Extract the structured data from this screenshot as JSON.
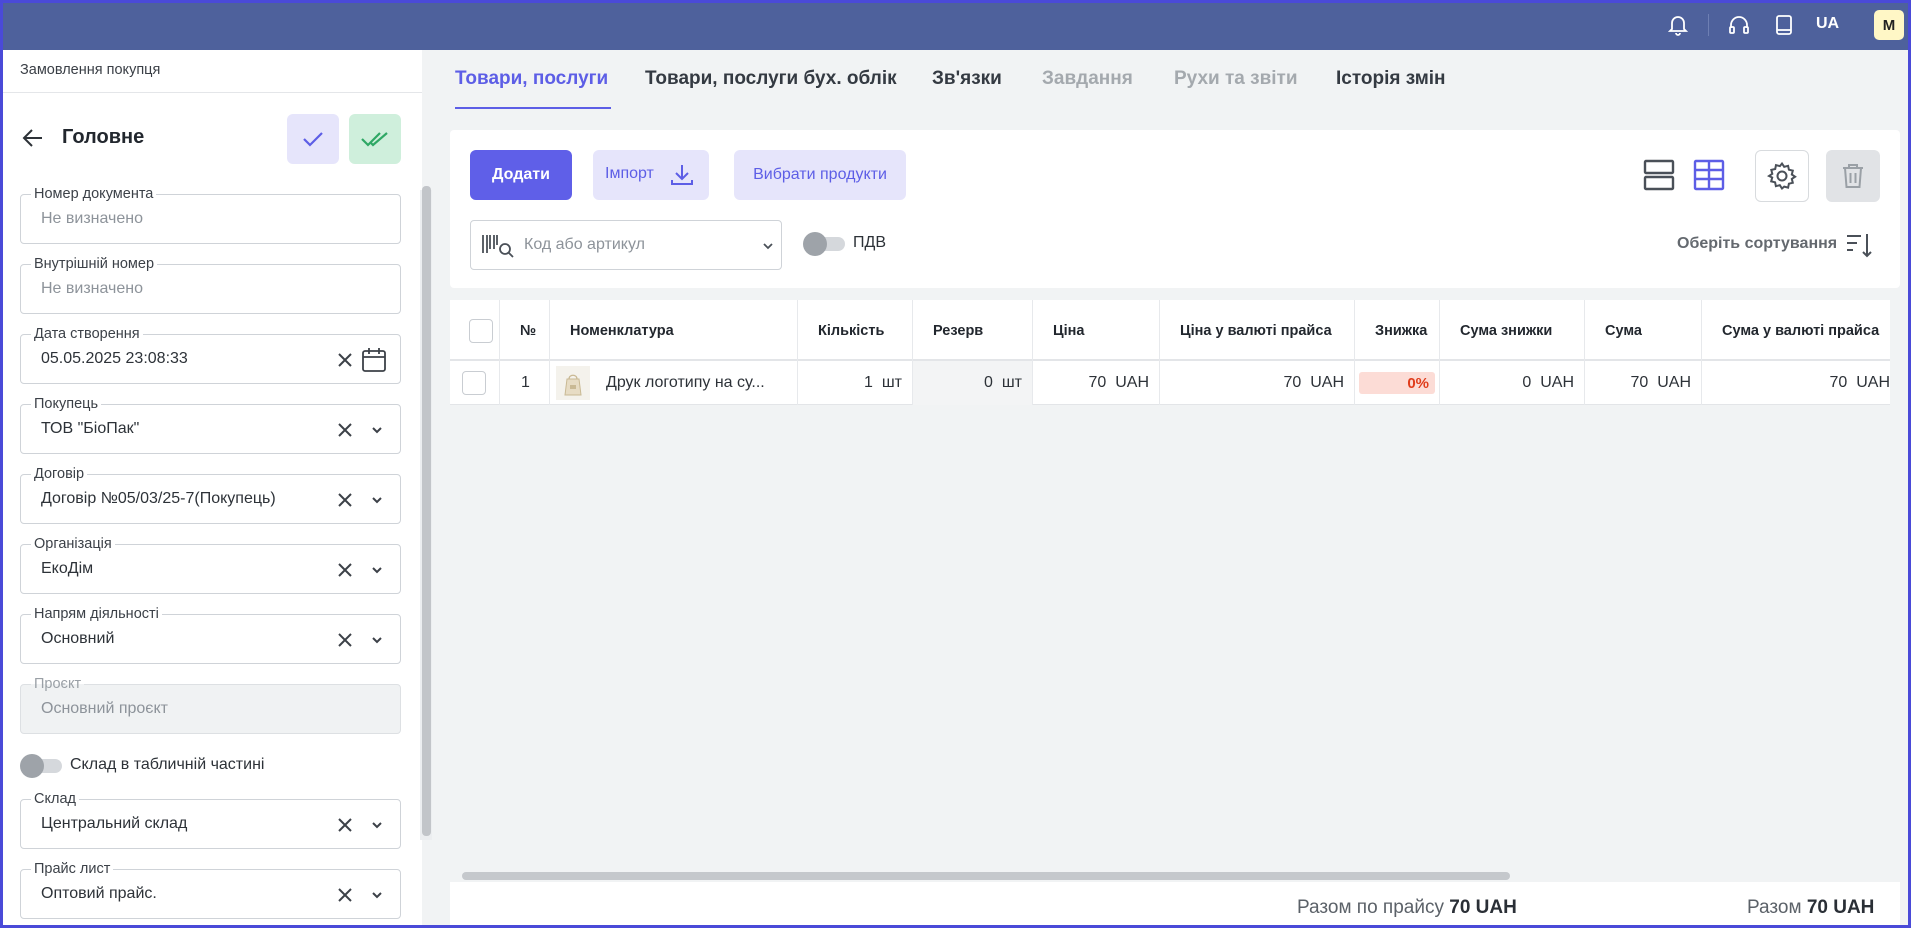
{
  "topbar": {
    "icons": [
      "bell-icon",
      "headset-icon",
      "book-icon"
    ],
    "language": "UA",
    "avatar_initial": "M"
  },
  "sidebar": {
    "breadcrumb": "Замовлення покупця",
    "title": "Головне",
    "fields": {
      "doc_number": {
        "label": "Номер документа",
        "placeholder": "Не визначено"
      },
      "internal_number": {
        "label": "Внутрішній номер",
        "placeholder": "Не визначено"
      },
      "created_date": {
        "label": "Дата створення",
        "value": "05.05.2025 23:08:33"
      },
      "buyer": {
        "label": "Покупець",
        "value": "ТОВ \"БіоПак\""
      },
      "contract": {
        "label": "Договір",
        "value": "Договір №05/03/25-7(Покупець)"
      },
      "organization": {
        "label": "Організація",
        "value": "ЕкоДім"
      },
      "activity": {
        "label": "Напрям діяльності",
        "value": "Основний"
      },
      "project": {
        "label": "Проєкт",
        "value": "Основний проєкт"
      },
      "warehouse_toggle": {
        "label": "Склад в табличній частині",
        "on": false
      },
      "warehouse": {
        "label": "Склад",
        "value": "Центральний склад"
      },
      "price_list": {
        "label": "Прайс лист",
        "value": "Оптовий прайс."
      }
    }
  },
  "tabs": [
    {
      "label": "Товари, послуги",
      "state": "active"
    },
    {
      "label": "Товари, послуги бух. облік",
      "state": "normal"
    },
    {
      "label": "Зв'язки",
      "state": "normal"
    },
    {
      "label": "Завдання",
      "state": "disabled"
    },
    {
      "label": "Рухи та звіти",
      "state": "disabled"
    },
    {
      "label": "Історія змін",
      "state": "normal"
    }
  ],
  "toolbar": {
    "add_label": "Додати",
    "import_label": "Імпорт",
    "choose_products_label": "Вибрати продукти",
    "search_placeholder": "Код або артикул",
    "vat_label": "ПДВ",
    "vat_on": false,
    "sort_label": "Оберіть сортування"
  },
  "table": {
    "columns": [
      "№",
      "Номенклатура",
      "Кількість",
      "Резерв",
      "Ціна",
      "Ціна у валюті прайса",
      "Знижка",
      "Сума знижки",
      "Сума",
      "Сума у валюті прайса"
    ],
    "rows": [
      {
        "num": "1",
        "name": "Друк логотипу на су...",
        "qty": "1",
        "qty_unit": "шт",
        "reserve": "0",
        "reserve_unit": "шт",
        "price": "70",
        "price_cur": "UAH",
        "price_list": "70",
        "price_list_cur": "UAH",
        "discount": "0%",
        "discount_sum": "0",
        "discount_sum_cur": "UAH",
        "sum": "70",
        "sum_cur": "UAH",
        "sum_list": "70",
        "sum_list_cur": "UAH"
      }
    ]
  },
  "footer": {
    "total_by_price_label": "Разом по прайсу",
    "total_by_price_value": "70 UAH",
    "total_label": "Разом",
    "total_value": "70 UAH"
  },
  "colors": {
    "accent": "#5d5ee6",
    "topbar": "#4e619c",
    "discount_bg": "#fcdcd6",
    "discount_text": "#e03d1c"
  }
}
